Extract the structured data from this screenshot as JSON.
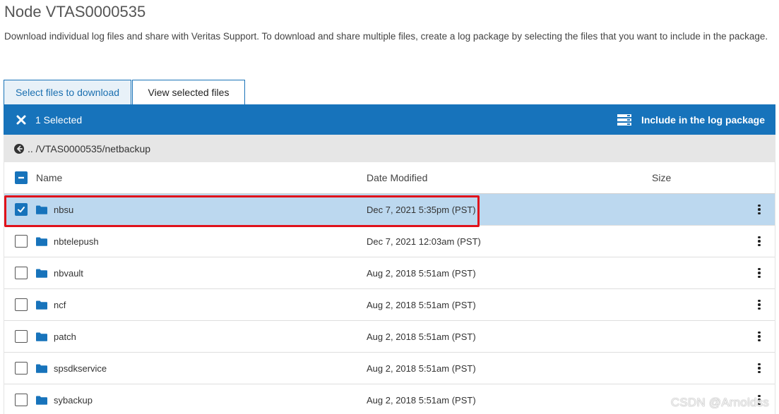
{
  "page": {
    "title": "Node VTAS0000535",
    "description": "Download individual log files and share with Veritas Support. To download and share multiple files, create a log package by selecting the files that you want to include in the package."
  },
  "tabs": [
    {
      "label": "Select files to download",
      "active": true
    },
    {
      "label": "View selected files",
      "active": false
    }
  ],
  "action_bar": {
    "selected_text": "1 Selected",
    "include_label": "Include in the log package",
    "bg_color": "#1773bb"
  },
  "breadcrumb": {
    "path": ".. /VTAS0000535/netbackup"
  },
  "table": {
    "columns": {
      "name": "Name",
      "date": "Date Modified",
      "size": "Size"
    },
    "rows": [
      {
        "name": "nbsu",
        "date": "Dec 7, 2021 5:35pm (PST)",
        "checked": true
      },
      {
        "name": "nbtelepush",
        "date": "Dec 7, 2021 12:03am (PST)",
        "checked": false
      },
      {
        "name": "nbvault",
        "date": "Aug 2, 2018 5:51am (PST)",
        "checked": false
      },
      {
        "name": "ncf",
        "date": "Aug 2, 2018 5:51am (PST)",
        "checked": false
      },
      {
        "name": "patch",
        "date": "Aug 2, 2018 5:51am (PST)",
        "checked": false
      },
      {
        "name": "spsdkservice",
        "date": "Aug 2, 2018 5:51am (PST)",
        "checked": false
      },
      {
        "name": "sybackup",
        "date": "Aug 2, 2018 5:51am (PST)",
        "checked": false
      }
    ]
  },
  "watermark": "CSDN @Arnoldss",
  "icons": {
    "clear": "close-icon",
    "include": "server-stack-icon",
    "back": "back-arrow-icon",
    "folder": "folder-icon",
    "more": "kebab-menu-icon",
    "check": "checkmark-icon"
  },
  "colors": {
    "accent": "#1773bb",
    "selected_row": "#bcd8ef",
    "highlight": "#e0121b"
  }
}
